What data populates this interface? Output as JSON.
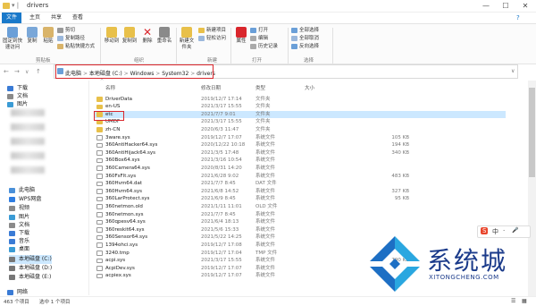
{
  "window": {
    "title": "drivers"
  },
  "tabs": [
    "文件",
    "主页",
    "共享",
    "查看"
  ],
  "ribbon": {
    "pin_label": "固定到快速访问",
    "copy_label": "复制",
    "paste_label": "粘贴",
    "copy_path_label": "复制路径",
    "paste_shortcut_label": "粘贴快捷方式",
    "cut_label": "剪切",
    "clipboard_group": "剪贴板",
    "move_to_label": "移动到",
    "copy_to_label": "复制到",
    "delete_label": "删除",
    "rename_label": "重命名",
    "organize_group": "组织",
    "new_folder_label": "新建文件夹",
    "new_item_label": "新建项目",
    "easy_access_label": "轻松访问",
    "new_group": "新建",
    "properties_label": "属性",
    "open_label": "打开",
    "edit_label": "编辑",
    "history_label": "历史记录",
    "open_group": "打开",
    "select_all_label": "全部选择",
    "select_none_label": "全部取消",
    "invert_label": "反向选择",
    "select_group": "选择"
  },
  "address": {
    "crumbs": [
      "此电脑",
      "本地磁盘 (C:)",
      "Windows",
      "System32",
      "drivers"
    ],
    "separator": ">"
  },
  "sidebar": {
    "items": [
      {
        "label": "下载",
        "icon": "download-icon",
        "color": "#3a7bd5"
      },
      {
        "label": "文档",
        "icon": "document-icon",
        "color": "#8a8a8a"
      },
      {
        "label": "图片",
        "icon": "picture-icon",
        "color": "#3a9bd5"
      },
      {
        "label": "此电脑",
        "icon": "computer-icon",
        "color": "#4a90d9"
      },
      {
        "label": "WPS网盘",
        "icon": "cloud-icon",
        "color": "#2f7de1"
      },
      {
        "label": "视频",
        "icon": "video-icon",
        "color": "#8a8a8a"
      },
      {
        "label": "图片",
        "icon": "picture-icon",
        "color": "#3a9bd5"
      },
      {
        "label": "文档",
        "icon": "document-icon",
        "color": "#8a8a8a"
      },
      {
        "label": "下载",
        "icon": "download-icon",
        "color": "#3a7bd5"
      },
      {
        "label": "音乐",
        "icon": "music-icon",
        "color": "#3a7bd5"
      },
      {
        "label": "桌面",
        "icon": "desktop-icon",
        "color": "#3a9bd5"
      },
      {
        "label": "本地磁盘 (C:)",
        "icon": "drive-icon",
        "color": "#777777"
      },
      {
        "label": "本地磁盘 (D:)",
        "icon": "drive-icon",
        "color": "#777777"
      },
      {
        "label": "本地磁盘 (E:)",
        "icon": "drive-icon",
        "color": "#777777"
      },
      {
        "label": "网络",
        "icon": "network-icon",
        "color": "#3a7bd5"
      }
    ]
  },
  "columns": {
    "name": "名称",
    "date": "修改日期",
    "type": "类型",
    "size": "大小"
  },
  "files": [
    {
      "name": "DriverData",
      "date": "2019/12/7 17:14",
      "type": "文件夹",
      "size": "",
      "kind": "folder"
    },
    {
      "name": "en-US",
      "date": "2021/3/17 15:55",
      "type": "文件夹",
      "size": "",
      "kind": "folder"
    },
    {
      "name": "etc",
      "date": "2021/7/7 9:01",
      "type": "文件夹",
      "size": "",
      "kind": "folder"
    },
    {
      "name": "UMDF",
      "date": "2021/3/17 15:55",
      "type": "文件夹",
      "size": "",
      "kind": "folder"
    },
    {
      "name": "zh-CN",
      "date": "2020/6/3 11:47",
      "type": "文件夹",
      "size": "",
      "kind": "folder"
    },
    {
      "name": "3ware.sys",
      "date": "2019/12/7 17:07",
      "type": "系统文件",
      "size": "105 KB",
      "kind": "file"
    },
    {
      "name": "360AntiHacker64.sys",
      "date": "2020/12/22 10:18",
      "type": "系统文件",
      "size": "194 KB",
      "kind": "file"
    },
    {
      "name": "360AntiHijack64.sys",
      "date": "2021/3/5 17:48",
      "type": "系统文件",
      "size": "340 KB",
      "kind": "file"
    },
    {
      "name": "360Box64.sys",
      "date": "2021/3/16 10:54",
      "type": "系统文件",
      "size": "",
      "kind": "file"
    },
    {
      "name": "360Camera64.sys",
      "date": "2020/8/31 14:20",
      "type": "系统文件",
      "size": "",
      "kind": "file"
    },
    {
      "name": "360FsFlt.sys",
      "date": "2021/6/28 9:02",
      "type": "系统文件",
      "size": "483 KB",
      "kind": "file"
    },
    {
      "name": "360Hvm64.dat",
      "date": "2021/7/7 8:45",
      "type": "DAT 文件",
      "size": "",
      "kind": "file"
    },
    {
      "name": "360Hvm64.sys",
      "date": "2021/6/8 14:52",
      "type": "系统文件",
      "size": "327 KB",
      "kind": "file"
    },
    {
      "name": "360LarProtect.sys",
      "date": "2021/6/9 8:45",
      "type": "系统文件",
      "size": "95 KB",
      "kind": "file"
    },
    {
      "name": "360netmon.old",
      "date": "2021/1/11 11:01",
      "type": "OLD 文件",
      "size": "",
      "kind": "file"
    },
    {
      "name": "360netmon.sys",
      "date": "2021/7/7 8:45",
      "type": "系统文件",
      "size": "",
      "kind": "file"
    },
    {
      "name": "360qpesv64.sys",
      "date": "2021/6/4 18:13",
      "type": "系统文件",
      "size": "",
      "kind": "file"
    },
    {
      "name": "360reskit64.sys",
      "date": "2021/5/6 15:33",
      "type": "系统文件",
      "size": "",
      "kind": "file"
    },
    {
      "name": "360Sensor64.sys",
      "date": "2021/5/22 14:25",
      "type": "系统文件",
      "size": "",
      "kind": "file"
    },
    {
      "name": "1394ohci.sys",
      "date": "2019/12/7 17:08",
      "type": "系统文件",
      "size": "",
      "kind": "file"
    },
    {
      "name": "3240.tmp",
      "date": "2019/12/7 17:04",
      "type": "TMP 文件",
      "size": "",
      "kind": "file"
    },
    {
      "name": "acpi.sys",
      "date": "2021/3/17 15:55",
      "type": "系统文件",
      "size": "790 KB",
      "kind": "file"
    },
    {
      "name": "AcpiDev.sys",
      "date": "2019/12/7 17:07",
      "type": "系统文件",
      "size": "",
      "kind": "file"
    },
    {
      "name": "acpiex.sys",
      "date": "2019/12/7 17:07",
      "type": "系统文件",
      "size": "",
      "kind": "file"
    }
  ],
  "status": {
    "count": "463 个项目",
    "selected": "选中 1 个项目"
  },
  "watermark": {
    "text": "系统城",
    "url": "XITONGCHENG.COM"
  },
  "ime": {
    "items": [
      "S",
      "中",
      "·",
      "🎤"
    ]
  },
  "colors": {
    "accent": "#1979ca",
    "highlight": "#d9262c",
    "folder": "#e8c04a",
    "selected": "#cce8ff"
  }
}
